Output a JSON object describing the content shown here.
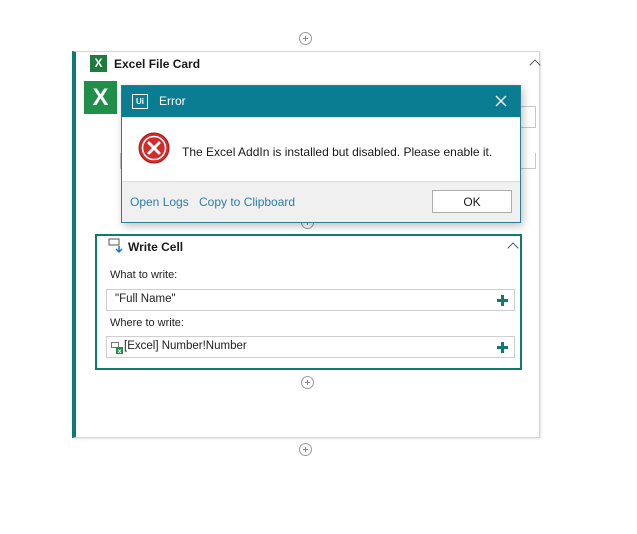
{
  "excel_card": {
    "title": "Excel File Card",
    "xl_icon_letter": "X"
  },
  "write_cell": {
    "title": "Write Cell",
    "what_label": "What to write:",
    "what_value": "\"Full Name\"",
    "where_label": "Where to write:",
    "where_value": "[Excel] Number!Number"
  },
  "dialog": {
    "app_logo": "Ui",
    "title": "Error",
    "message": "The Excel AddIn is installed but disabled. Please enable it.",
    "open_logs": "Open Logs",
    "copy_clipboard": "Copy to Clipboard",
    "ok_label": "OK"
  },
  "colors": {
    "accent_teal": "#0e7a72",
    "dialog_titlebar": "#0b7d93",
    "excel_green": "#1f8f4a",
    "error_red": "#d42a2a",
    "link_blue": "#2b7fa8"
  },
  "icons": {
    "add": "plus-circle-icon",
    "collapse": "chevron-up-icon",
    "excel": "excel-icon",
    "write_cell": "write-cell-icon",
    "error": "error-x-icon",
    "close": "close-icon",
    "expression_plus": "plus-icon"
  }
}
